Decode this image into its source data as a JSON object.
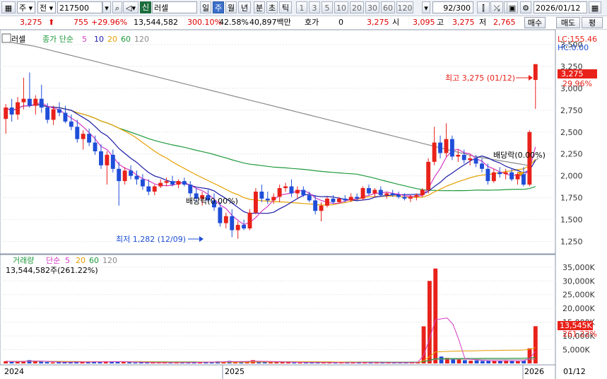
{
  "toolbar": {
    "type_label": "주",
    "type2_label": "전",
    "code": "217500",
    "sin_label": "신",
    "name": "러셀",
    "periods": [
      "일",
      "주",
      "월",
      "년",
      "분",
      "초",
      "틱"
    ],
    "active_period": 1,
    "intervals": [
      "1",
      "3",
      "5",
      "10",
      "20",
      "30",
      "60",
      "120"
    ],
    "page_counter": "92/300",
    "date": "2026/01/12"
  },
  "quote": {
    "price": "3,275",
    "change": "755",
    "change_pct": "+29.96%",
    "volume": "13,544,582",
    "volume_ratio": "300.10%",
    "turnover_rate": "42.58%",
    "amount": "40,897백만",
    "hoga_label": "호가",
    "hoga_value": "0",
    "ask": "3,275",
    "open_label": "시",
    "open": "3,095",
    "high_label": "고",
    "high": "3,275",
    "low_label": "저",
    "low": "2,765",
    "buy_label": "매수",
    "sell_label": "매도",
    "eval_label": "평"
  },
  "price_panel": {
    "name_label": "러셀",
    "ma_label": "종가 단순",
    "ma_periods": [
      "5",
      "10",
      "20",
      "60",
      "120"
    ],
    "lc_label": "LC:155.46",
    "hc_label": "HC:0.00",
    "high_annot": "최고 3,275 (01/12)",
    "low_annot": "최저 1,282 (12/09)",
    "div_annot": "배당락(0.00%)",
    "div_annot2": "배당락(0.00%)",
    "last_price_tag": "3,275",
    "last_pct_tag": "29.96%"
  },
  "volume_panel": {
    "title": "거래량",
    "ma_label": "단순",
    "ma_periods": [
      "5",
      "20",
      "60",
      "120"
    ],
    "current": "13,544,582주(261.22%)",
    "last_tag": "13,545K",
    "last_pct_tag": "261.22%"
  },
  "x_labels": [
    "2024",
    "2025",
    "2026",
    "01/12"
  ],
  "colors": {
    "up": "#e8221a",
    "down": "#1f4ed8",
    "ma5": "#d63cc4",
    "ma10": "#1a1aa8",
    "ma20": "#e6a000",
    "ma60": "#1e9a3c",
    "ma120": "#8a8a8a"
  },
  "chart_data": [
    {
      "type": "candlestick",
      "title": "러셀",
      "y_ticks": [
        1250,
        1500,
        1750,
        2000,
        2250,
        2500,
        2750,
        3000,
        3250,
        3500
      ],
      "ylim": [
        1150,
        3620
      ],
      "candles_ohlc": [
        [
          2650,
          2820,
          2480,
          2780
        ],
        [
          2780,
          2880,
          2620,
          2700
        ],
        [
          2700,
          2900,
          2640,
          2840
        ],
        [
          2840,
          3120,
          2760,
          2880
        ],
        [
          2880,
          3180,
          2780,
          2800
        ],
        [
          2800,
          2920,
          2700,
          2880
        ],
        [
          2880,
          3040,
          2720,
          2780
        ],
        [
          2780,
          2830,
          2600,
          2640
        ],
        [
          2640,
          2800,
          2580,
          2760
        ],
        [
          2760,
          2840,
          2680,
          2720
        ],
        [
          2720,
          2800,
          2600,
          2620
        ],
        [
          2620,
          2700,
          2520,
          2560
        ],
        [
          2560,
          2640,
          2380,
          2420
        ],
        [
          2420,
          2520,
          2300,
          2480
        ],
        [
          2480,
          2540,
          2340,
          2380
        ],
        [
          2380,
          2460,
          2240,
          2280
        ],
        [
          2280,
          2360,
          2080,
          2120
        ],
        [
          2120,
          2280,
          1900,
          2240
        ],
        [
          2240,
          2300,
          2040,
          2080
        ],
        [
          2080,
          2160,
          1660,
          1940
        ],
        [
          1940,
          2100,
          1900,
          2060
        ],
        [
          2060,
          2120,
          1960,
          2000
        ],
        [
          2000,
          2060,
          1900,
          1960
        ],
        [
          1960,
          2020,
          1840,
          1880
        ],
        [
          1880,
          1960,
          1780,
          1820
        ],
        [
          1820,
          1900,
          1780,
          1880
        ],
        [
          1880,
          1960,
          1860,
          1920
        ],
        [
          1920,
          1980,
          1880,
          1940
        ],
        [
          1940,
          2000,
          1880,
          1900
        ],
        [
          1900,
          1960,
          1860,
          1940
        ],
        [
          1940,
          1980,
          1880,
          1900
        ],
        [
          1900,
          1940,
          1760,
          1800
        ],
        [
          1800,
          1860,
          1700,
          1740
        ],
        [
          1740,
          1820,
          1660,
          1780
        ],
        [
          1780,
          1840,
          1700,
          1720
        ],
        [
          1720,
          1800,
          1600,
          1640
        ],
        [
          1640,
          1700,
          1420,
          1460
        ],
        [
          1460,
          1580,
          1400,
          1540
        ],
        [
          1540,
          1620,
          1300,
          1380
        ],
        [
          1380,
          1480,
          1282,
          1440
        ],
        [
          1440,
          1500,
          1380,
          1400
        ],
        [
          1400,
          1620,
          1380,
          1580
        ],
        [
          1580,
          1860,
          1560,
          1820
        ],
        [
          1820,
          1900,
          1700,
          1740
        ],
        [
          1740,
          1820,
          1680,
          1720
        ],
        [
          1720,
          1800,
          1680,
          1760
        ],
        [
          1760,
          1900,
          1700,
          1860
        ],
        [
          1860,
          1920,
          1820,
          1880
        ],
        [
          1880,
          1960,
          1760,
          1800
        ],
        [
          1800,
          1880,
          1740,
          1840
        ],
        [
          1840,
          1880,
          1760,
          1780
        ],
        [
          1780,
          1820,
          1700,
          1720
        ],
        [
          1720,
          1780,
          1560,
          1600
        ],
        [
          1600,
          1700,
          1480,
          1660
        ],
        [
          1660,
          1760,
          1640,
          1740
        ],
        [
          1740,
          1780,
          1680,
          1700
        ],
        [
          1700,
          1760,
          1680,
          1740
        ],
        [
          1740,
          1780,
          1700,
          1720
        ],
        [
          1720,
          1800,
          1700,
          1760
        ],
        [
          1760,
          1800,
          1720,
          1740
        ],
        [
          1740,
          1880,
          1720,
          1860
        ],
        [
          1860,
          1900,
          1780,
          1800
        ],
        [
          1800,
          1860,
          1760,
          1840
        ],
        [
          1840,
          1880,
          1760,
          1780
        ],
        [
          1780,
          1820,
          1740,
          1800
        ],
        [
          1800,
          1840,
          1760,
          1780
        ],
        [
          1780,
          1820,
          1740,
          1760
        ],
        [
          1760,
          1800,
          1720,
          1740
        ],
        [
          1740,
          1780,
          1700,
          1760
        ],
        [
          1760,
          1800,
          1720,
          1780
        ],
        [
          1780,
          1860,
          1760,
          1840
        ],
        [
          1840,
          2200,
          1800,
          2160
        ],
        [
          2160,
          2560,
          2120,
          2380
        ],
        [
          2380,
          2460,
          2200,
          2260
        ],
        [
          2260,
          2600,
          2220,
          2420
        ],
        [
          2420,
          2460,
          2180,
          2220
        ],
        [
          2220,
          2300,
          2160,
          2240
        ],
        [
          2240,
          2300,
          2140,
          2180
        ],
        [
          2180,
          2240,
          2120,
          2200
        ],
        [
          2200,
          2240,
          2100,
          2140
        ],
        [
          2140,
          2200,
          2040,
          2080
        ],
        [
          2080,
          2140,
          1900,
          1940
        ],
        [
          1940,
          2080,
          1920,
          2040
        ],
        [
          2040,
          2100,
          1980,
          2020
        ],
        [
          2020,
          2080,
          1960,
          2040
        ],
        [
          2040,
          2080,
          1940,
          1960
        ],
        [
          1960,
          2040,
          1900,
          2020
        ],
        [
          2020,
          2100,
          1880,
          1900
        ],
        [
          1900,
          2520,
          1880,
          2500
        ],
        [
          3095,
          3275,
          2765,
          3275
        ]
      ],
      "ma5": [
        2650,
        2700,
        2740,
        2770,
        2780,
        2760,
        2740,
        2740,
        2700,
        2640,
        2560,
        2460,
        2380,
        2320,
        2240,
        2160,
        2100,
        2050,
        2020,
        1980,
        1950,
        1900,
        1870,
        1860,
        1860,
        1870,
        1880,
        1870,
        1840,
        1800,
        1750,
        1700,
        1640,
        1580,
        1500,
        1450,
        1440,
        1480,
        1540,
        1610,
        1680,
        1730,
        1760,
        1800,
        1810,
        1790,
        1760,
        1720,
        1700,
        1690,
        1700,
        1710,
        1720,
        1730,
        1740,
        1750,
        1760,
        1770,
        1770,
        1780,
        1780,
        1780,
        1770,
        1760,
        1800,
        1900,
        2020,
        2140,
        2240,
        2300,
        2300,
        2250,
        2200,
        2160,
        2120,
        2080,
        2040,
        2010,
        2020,
        2100,
        2300
      ],
      "ma120": [
        3540,
        3520,
        3500,
        3480,
        3450,
        3420,
        3390,
        3360,
        3330,
        3300,
        3270,
        3240,
        3210,
        3180,
        3150,
        3120,
        3090,
        3060,
        3030,
        3000,
        2970,
        2940,
        2910,
        2880,
        2850,
        2820,
        2790,
        2760,
        2730,
        2700,
        2670,
        2640,
        2610,
        2580,
        2550,
        2520,
        2490,
        2460,
        2430,
        2400,
        2370,
        2340,
        2310,
        2280,
        2250,
        2220,
        2200,
        2180,
        2160,
        2140,
        2120,
        2200
      ]
    },
    {
      "type": "bar",
      "title": "거래량",
      "y_ticks": [
        5000,
        10000,
        15000,
        20000,
        25000,
        30000,
        35000
      ],
      "y_tick_labels": [
        "5,000K",
        "10,000K",
        "15,000K",
        "20,000K",
        "25,000K",
        "30,000K",
        "35,000K"
      ],
      "ylim": [
        0,
        36500
      ],
      "volumes_k": [
        800,
        600,
        700,
        900,
        1200,
        700,
        600,
        500,
        400,
        500,
        400,
        600,
        700,
        500,
        400,
        600,
        700,
        800,
        600,
        700,
        500,
        400,
        300,
        400,
        300,
        300,
        200,
        250,
        300,
        350,
        300,
        400,
        500,
        400,
        600,
        500,
        700,
        600,
        900,
        700,
        600,
        800,
        1200,
        700,
        500,
        400,
        600,
        500,
        400,
        300,
        300,
        350,
        400,
        300,
        250,
        300,
        300,
        250,
        300,
        350,
        300,
        300,
        300,
        250,
        250,
        300,
        250,
        300,
        300,
        400,
        600,
        13500,
        30000,
        34500,
        2500,
        2000,
        1800,
        1400,
        1200,
        1000,
        1100,
        900,
        1000,
        900,
        1000,
        1100,
        900,
        800,
        1000,
        5500,
        13545
      ]
    }
  ]
}
